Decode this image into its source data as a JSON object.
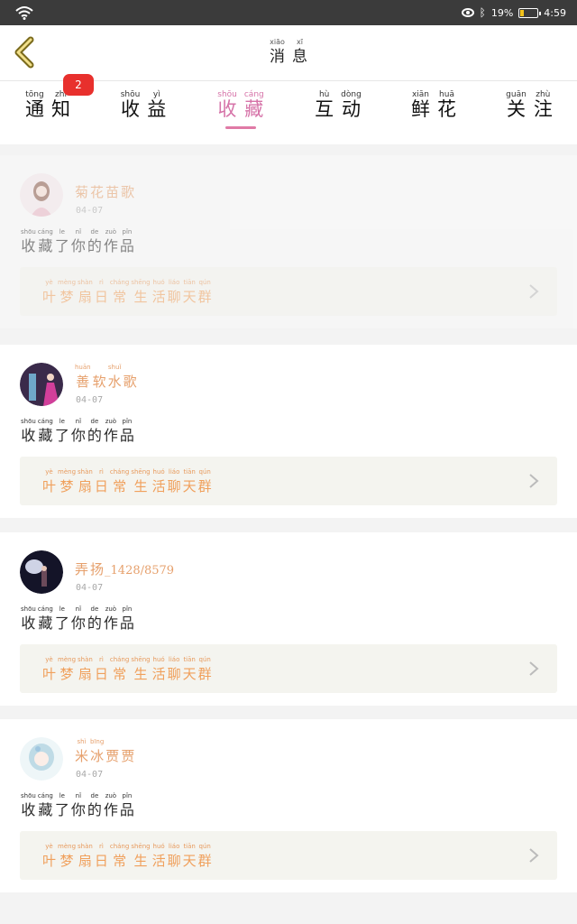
{
  "status": {
    "battery": "19%",
    "time": "4:59"
  },
  "header": {
    "title": [
      {
        "py": "xiāo",
        "ch": "消"
      },
      {
        "py": "xī",
        "ch": "息"
      }
    ]
  },
  "tabs": [
    {
      "chars": [
        {
          "py": "tōng",
          "ch": "通"
        },
        {
          "py": "zhī",
          "ch": "知"
        }
      ]
    },
    {
      "chars": [
        {
          "py": "shōu",
          "ch": "收"
        },
        {
          "py": "yì",
          "ch": "益"
        }
      ]
    },
    {
      "chars": [
        {
          "py": "shōu",
          "ch": "收"
        },
        {
          "py": "cáng",
          "ch": "藏"
        }
      ]
    },
    {
      "chars": [
        {
          "py": "hù",
          "ch": "互"
        },
        {
          "py": "dòng",
          "ch": "动"
        }
      ]
    },
    {
      "chars": [
        {
          "py": "xiān",
          "ch": "鲜"
        },
        {
          "py": "huā",
          "ch": "花"
        }
      ]
    },
    {
      "chars": [
        {
          "py": "guān",
          "ch": "关"
        },
        {
          "py": "zhù",
          "ch": "注"
        }
      ]
    }
  ],
  "notice_badge": "2",
  "action_text": [
    {
      "py": "shōu",
      "ch": "收"
    },
    {
      "py": "cáng",
      "ch": "藏"
    },
    {
      "py": "le",
      "ch": "了"
    },
    {
      "py": "nǐ",
      "ch": "你"
    },
    {
      "py": "de",
      "ch": "的"
    },
    {
      "py": "zuò",
      "ch": "作"
    },
    {
      "py": "pǐn",
      "ch": "品"
    }
  ],
  "work_title": [
    {
      "py": "yè",
      "ch": "叶"
    },
    {
      "py": "mèng",
      "ch": "梦"
    },
    {
      "py": "shàn",
      "ch": "扇"
    },
    {
      "py": "rì",
      "ch": "日"
    },
    {
      "py": "cháng",
      "ch": "常"
    },
    {
      "py": "shēng",
      "ch": "生"
    },
    {
      "py": "huó",
      "ch": "活"
    },
    {
      "py": "liáo",
      "ch": "聊"
    },
    {
      "py": "tiān",
      "ch": "天"
    },
    {
      "py": "qún",
      "ch": "群"
    }
  ],
  "items": [
    {
      "name_ruby": [
        {
          "py": "",
          "ch": "菊"
        },
        {
          "py": "",
          "ch": "花"
        },
        {
          "py": "",
          "ch": "苗"
        },
        {
          "py": "",
          "ch": "歌"
        }
      ],
      "date": "04-07",
      "avatar_color": "#e7c9cf"
    },
    {
      "name_ruby": [
        {
          "py": "huān",
          "ch": "善"
        },
        {
          "py": "",
          "ch": "软"
        },
        {
          "py": "shuǐ",
          "ch": "水"
        },
        {
          "py": "",
          "ch": "歌"
        }
      ],
      "date": "04-07",
      "avatar_color": "#7a3d7c"
    },
    {
      "name_ruby": [
        {
          "py": "",
          "ch": "弄"
        },
        {
          "py": "",
          "ch": "扬"
        }
      ],
      "name_plain": "_1428/8579",
      "date": "04-07",
      "avatar_color": "#1c1c2e"
    },
    {
      "name_ruby": [
        {
          "py": "shì",
          "ch": "米"
        },
        {
          "py": "bīng",
          "ch": "冰"
        },
        {
          "py": "",
          "ch": "贾"
        },
        {
          "py": "",
          "ch": "贾"
        }
      ],
      "date": "04-07",
      "avatar_color": "#cde6ee"
    }
  ]
}
